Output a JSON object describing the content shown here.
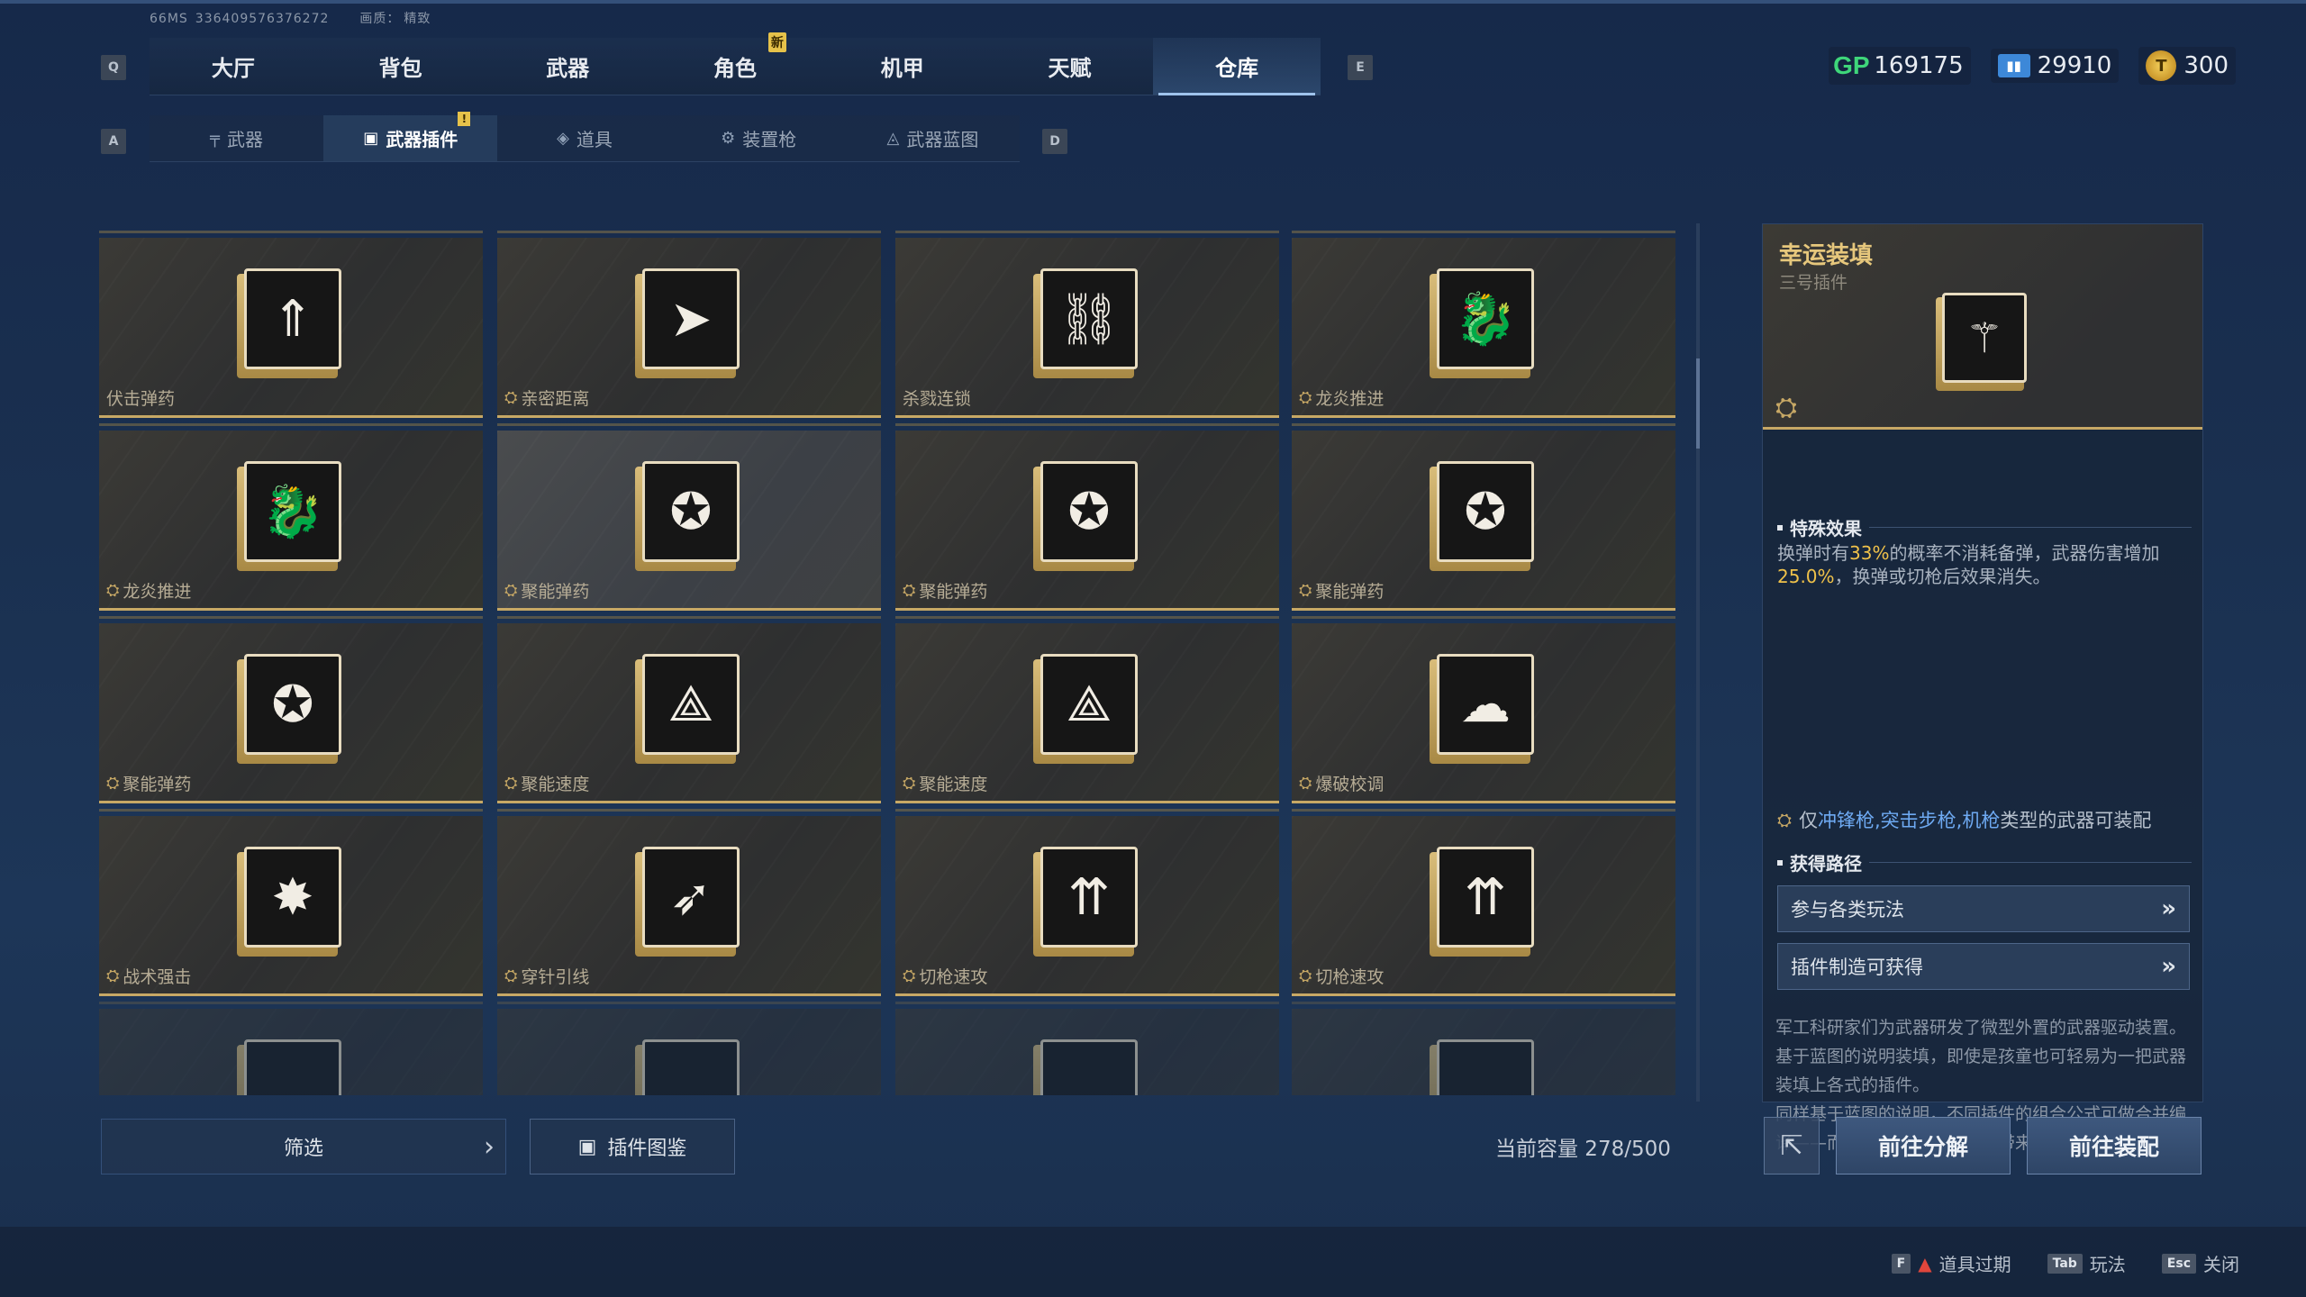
{
  "system": {
    "ms": "66MS",
    "uid": "336409576376272",
    "quality_label": "画质：",
    "quality_value": "精致"
  },
  "keys": {
    "main_prev": "Q",
    "main_next": "E",
    "sub_prev": "A",
    "sub_next": "D"
  },
  "main_tabs": [
    {
      "label": "大厅"
    },
    {
      "label": "背包"
    },
    {
      "label": "武器"
    },
    {
      "label": "角色",
      "badge": "新"
    },
    {
      "label": "机甲"
    },
    {
      "label": "天赋"
    },
    {
      "label": "仓库",
      "active": true
    }
  ],
  "currencies": [
    {
      "icon": "gp-icon",
      "value": "169175",
      "color": "#3ed67a"
    },
    {
      "icon": "ticket-icon",
      "value": "29910",
      "color": "#3d88d8"
    },
    {
      "icon": "coin-icon",
      "value": "300",
      "color": "#e0b040"
    }
  ],
  "sub_tabs": [
    {
      "label": "武器",
      "icon": "rifle-icon"
    },
    {
      "label": "武器插件",
      "icon": "chip-icon",
      "active": true,
      "badge": "!"
    },
    {
      "label": "道具",
      "icon": "grenade-icon"
    },
    {
      "label": "装置枪",
      "icon": "gear-gun-icon"
    },
    {
      "label": "武器蓝图",
      "icon": "blueprint-icon"
    }
  ],
  "items": [
    {
      "name": "伏击弹药",
      "icon": "⇑",
      "marked": false
    },
    {
      "name": "亲密距离",
      "icon": "➤",
      "marked": true
    },
    {
      "name": "杀戮连锁",
      "icon": "⛓",
      "marked": false
    },
    {
      "name": "龙炎推进",
      "icon": "🐉",
      "marked": true
    },
    {
      "name": "龙炎推进",
      "icon": "🐉",
      "marked": true
    },
    {
      "name": "聚能弹药",
      "icon": "✪",
      "marked": true,
      "hover": true
    },
    {
      "name": "聚能弹药",
      "icon": "✪",
      "marked": true
    },
    {
      "name": "聚能弹药",
      "icon": "✪",
      "marked": true
    },
    {
      "name": "聚能弹药",
      "icon": "✪",
      "marked": true
    },
    {
      "name": "聚能速度",
      "icon": "⟁",
      "marked": true
    },
    {
      "name": "聚能速度",
      "icon": "⟁",
      "marked": true
    },
    {
      "name": "爆破校调",
      "icon": "☁",
      "marked": true
    },
    {
      "name": "战术强击",
      "icon": "✸",
      "marked": true
    },
    {
      "name": "穿针引线",
      "icon": "➶",
      "marked": true
    },
    {
      "name": "切枪速攻",
      "icon": "⇈",
      "marked": true
    },
    {
      "name": "切枪速攻",
      "icon": "⇈",
      "marked": true
    }
  ],
  "filter": {
    "label": "筛选"
  },
  "atlas": {
    "label": "插件图鉴"
  },
  "capacity": {
    "text": "当前容量 278/500"
  },
  "detail": {
    "title": "幸运装填",
    "subtitle": "三号插件",
    "icon": "bullet-wings-icon",
    "effect_section": "特殊效果",
    "effect_parts": [
      "换弹时有",
      "33%",
      "的概率不消耗备弹，武器伤害增加",
      "25.0%",
      "，换弹或切枪后效果消失。"
    ],
    "restriction_parts": [
      "仅",
      "冲锋枪,突击步枪,机枪",
      "类型的武器可装配"
    ],
    "path_section": "获得路径",
    "paths": [
      "参与各类玩法",
      "插件制造可获得"
    ],
    "lore": "军工科研家们为武器研发了微型外置的武器驱动装置。\n基于蓝图的说明装填，即使是孩童也可轻易为一把武器装填上各式的插件。\n同样基于蓝图的说明，不同插件的组合公式可做合并编译——而这编译往往能为武器带来更强大的效力。"
  },
  "actions": {
    "decompose": "前往分解",
    "equip": "前往装配"
  },
  "hints": [
    {
      "key": "F",
      "label": "道具过期",
      "warn": true
    },
    {
      "key": "Tab",
      "label": "玩法"
    },
    {
      "key": "Esc",
      "label": "关闭"
    }
  ]
}
